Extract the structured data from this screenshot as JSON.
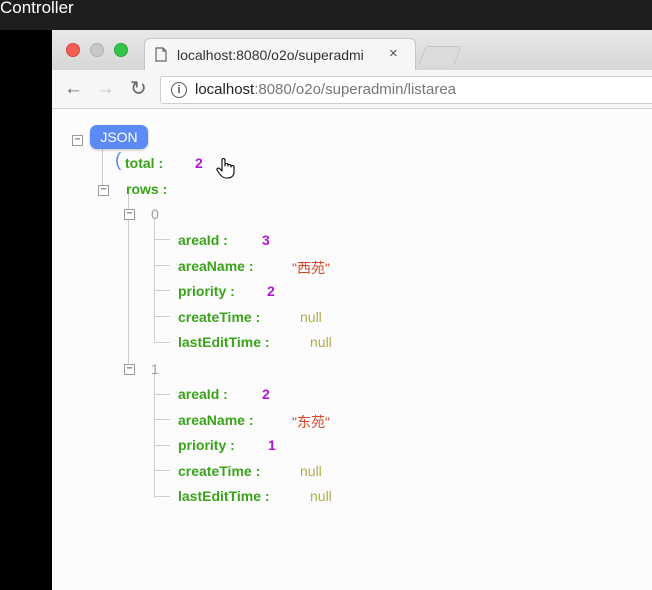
{
  "window": {
    "title": "Controller"
  },
  "browser": {
    "tab": {
      "title": "localhost:8080/o2o/superadmi",
      "close": "×"
    },
    "toolbar": {
      "back": "←",
      "forward": "→",
      "reload": "↻",
      "info": "i",
      "url_host": "localhost",
      "url_path": ":8080/o2o/superadmin/listarea"
    }
  },
  "json_viewer": {
    "root_label": "JSON",
    "collapse_glyph": "−",
    "total_key": "total :",
    "total_value": "2",
    "rows_key": "rows :",
    "rows": [
      {
        "index": "0",
        "fields": [
          {
            "key": "areaId :",
            "value": "3",
            "kind": "num"
          },
          {
            "key": "areaName :",
            "value": "\"西苑\"",
            "kind": "str"
          },
          {
            "key": "priority :",
            "value": "2",
            "kind": "num"
          },
          {
            "key": "createTime :",
            "value": "null",
            "kind": "nil"
          },
          {
            "key": "lastEditTime :",
            "value": "null",
            "kind": "nil"
          }
        ]
      },
      {
        "index": "1",
        "fields": [
          {
            "key": "areaId :",
            "value": "2",
            "kind": "num"
          },
          {
            "key": "areaName :",
            "value": "\"东苑\"",
            "kind": "str"
          },
          {
            "key": "priority :",
            "value": "1",
            "kind": "num"
          },
          {
            "key": "createTime :",
            "value": "null",
            "kind": "nil"
          },
          {
            "key": "lastEditTime :",
            "value": "null",
            "kind": "nil"
          }
        ]
      }
    ]
  },
  "colors": {
    "key": "#3aa31a",
    "number": "#b114d6",
    "string": "#d8472a",
    "null": "#b0ae4a",
    "badge": "#5b8af6"
  }
}
